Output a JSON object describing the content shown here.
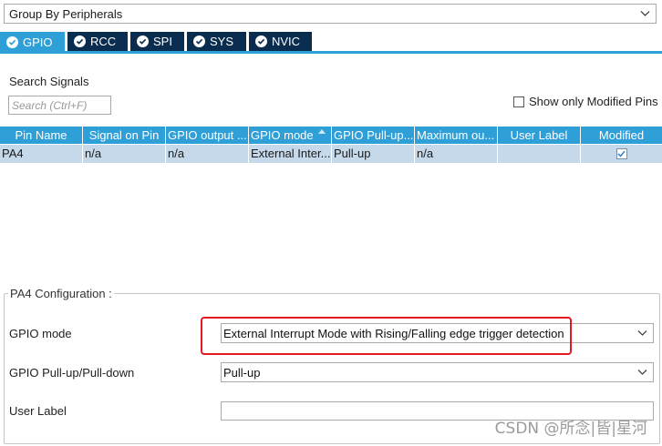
{
  "group_by": {
    "value": "Group By Peripherals"
  },
  "tabs": [
    {
      "label": "GPIO",
      "active": true
    },
    {
      "label": "RCC",
      "active": false
    },
    {
      "label": "SPI",
      "active": false
    },
    {
      "label": "SYS",
      "active": false
    },
    {
      "label": "NVIC",
      "active": false
    }
  ],
  "search": {
    "label": "Search Signals",
    "placeholder": "Search (Ctrl+F)"
  },
  "filter": {
    "label": "Show only Modified Pins",
    "checked": false
  },
  "table": {
    "headers": [
      "Pin Name",
      "Signal on Pin",
      "GPIO output ...",
      "GPIO mode",
      "GPIO Pull-up...",
      "Maximum ou...",
      "User Label",
      "Modified"
    ],
    "rows": [
      {
        "pin": "PA4",
        "signal": "n/a",
        "output": "n/a",
        "mode": "External Inter...",
        "pull": "Pull-up",
        "max": "n/a",
        "user_label": "",
        "modified": true
      }
    ]
  },
  "config": {
    "title": "PA4 Configuration :",
    "gpio_mode_label": "GPIO mode",
    "gpio_mode_value": "External Interrupt Mode with Rising/Falling edge trigger detection",
    "pull_label": "GPIO Pull-up/Pull-down",
    "pull_value": "Pull-up",
    "user_label_label": "User Label",
    "user_label_value": ""
  },
  "watermark": "CSDN @所念|皆|星河",
  "colors": {
    "accent": "#2f9fd8",
    "tab_dark": "#0a2c4e",
    "row_selected": "#c6d9ea",
    "highlight": "#e8161e"
  }
}
